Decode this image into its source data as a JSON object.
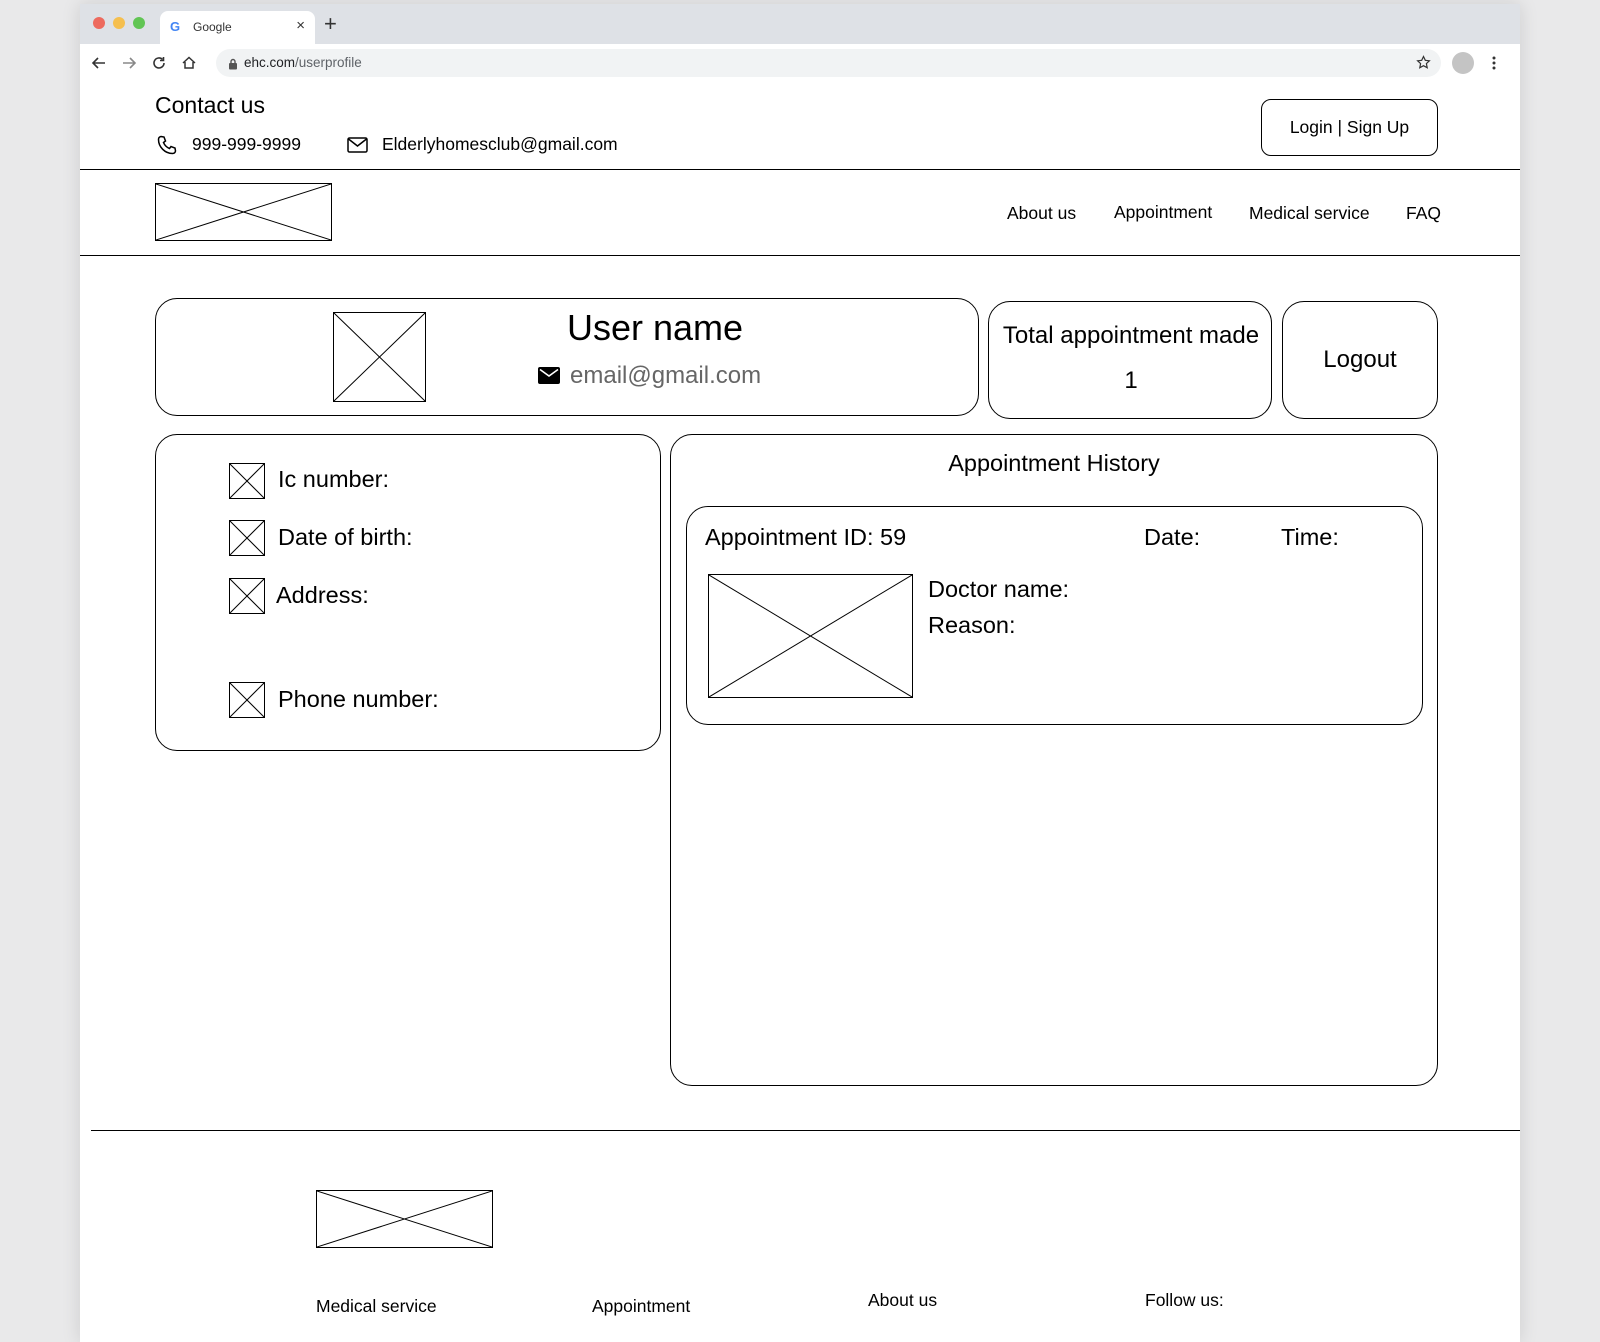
{
  "browser": {
    "tab_title": "Google",
    "favicon_letter": "G",
    "url_host": "ehc.com",
    "url_path": "/userprofile"
  },
  "contact": {
    "title": "Contact us",
    "phone": "999-999-9999",
    "email": "Elderlyhomesclub@gmail.com"
  },
  "header": {
    "login_label": "Login | Sign Up",
    "nav": [
      "About us",
      "Appointment",
      "Medical service",
      "FAQ"
    ]
  },
  "profile": {
    "user_name": "User name",
    "email": "email@gmail.com",
    "total_label": "Total appointment made",
    "total_value": "1",
    "logout_label": "Logout"
  },
  "details": {
    "ic_label": "Ic number:",
    "dob_label": "Date of birth:",
    "address_label": "Address:",
    "phone_label": "Phone number:"
  },
  "history": {
    "title": "Appointment History",
    "appointment_id": "Appointment ID: 59",
    "date_label": "Date:",
    "time_label": "Time:",
    "doctor_label": "Doctor name:",
    "reason_label": "Reason:"
  },
  "footer": {
    "links": [
      "Medical service",
      "Appointment",
      "About us",
      "Follow us:"
    ]
  }
}
